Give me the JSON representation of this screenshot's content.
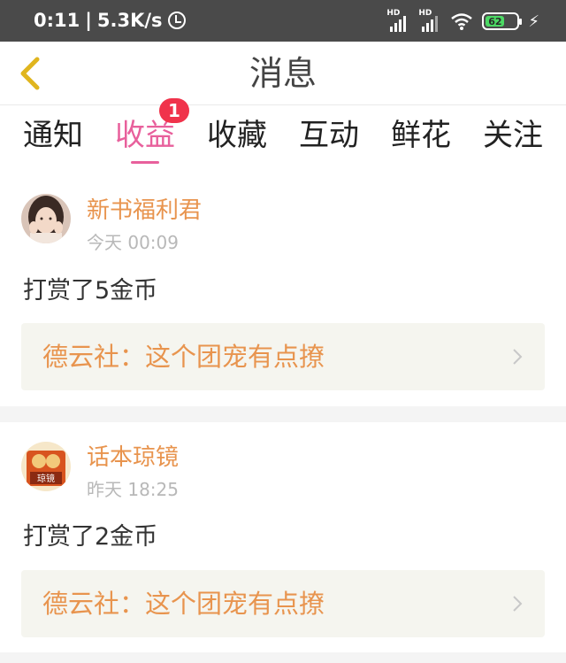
{
  "status_bar": {
    "time": "0:11",
    "network_speed": "5.3K/s",
    "signal_1_label": "HD",
    "signal_2_label": "HD",
    "battery_percent": "62",
    "battery_color": "#4cd964"
  },
  "nav": {
    "title": "消息",
    "back_icon": "chevron-left-icon",
    "back_icon_color": "#e0b51e"
  },
  "tabs": [
    {
      "label": "通知",
      "active": false
    },
    {
      "label": "收益",
      "active": true,
      "badge": "1"
    },
    {
      "label": "收藏",
      "active": false
    },
    {
      "label": "互动",
      "active": false
    },
    {
      "label": "鲜花",
      "active": false
    },
    {
      "label": "关注",
      "active": false
    }
  ],
  "colors": {
    "accent_pink": "#e8609c",
    "sender_orange": "#e8944e",
    "badge_red": "#f0334b",
    "card_background": "#f5f5ef"
  },
  "messages": [
    {
      "sender": "新书福利君",
      "time": "今天 00:09",
      "body": "打赏了5金币",
      "book_title": "德云社：这个团宠有点撩"
    },
    {
      "sender": "话本琼镜",
      "time": "昨天 18:25",
      "body": "打赏了2金币",
      "book_title": "德云社：这个团宠有点撩"
    }
  ]
}
